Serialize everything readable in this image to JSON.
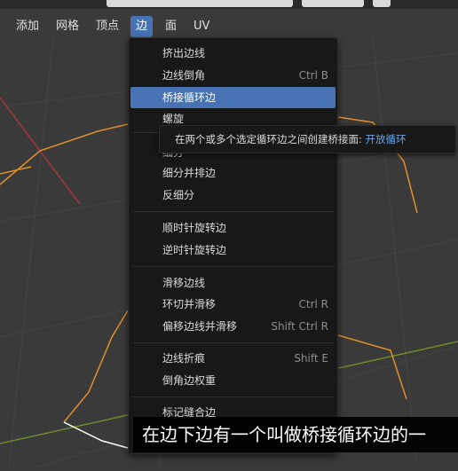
{
  "colors": {
    "viewport_bg": "#3a3a3a",
    "grid": "#444444",
    "x_axis": "#a1383f",
    "y_axis": "#6e8b2a",
    "mesh_edge": "#e0902a",
    "selected_edge": "#ffffff",
    "highlight": "#4772b3",
    "menu_bg": "#181818",
    "tooltip_accent": "#6ea6e6"
  },
  "menubar": {
    "items": [
      {
        "label": "添加",
        "active": false
      },
      {
        "label": "网格",
        "active": false
      },
      {
        "label": "顶点",
        "active": false
      },
      {
        "label": "边",
        "active": true
      },
      {
        "label": "面",
        "active": false
      },
      {
        "label": "UV",
        "active": false
      }
    ]
  },
  "dropdown": {
    "items": [
      {
        "label": "挤出边线",
        "shortcut": ""
      },
      {
        "label": "边线倒角",
        "shortcut": "Ctrl B"
      },
      {
        "label": "桥接循环边",
        "shortcut": "",
        "highlighted": true
      },
      {
        "label": "螺旋",
        "shortcut": ""
      },
      {
        "label": "细分",
        "shortcut": ""
      },
      {
        "label": "细分并排边",
        "shortcut": ""
      },
      {
        "label": "反细分",
        "shortcut": ""
      },
      {
        "label": "顺时针旋转边",
        "shortcut": ""
      },
      {
        "label": "逆时针旋转边",
        "shortcut": ""
      },
      {
        "label": "滑移边线",
        "shortcut": ""
      },
      {
        "label": "环切并滑移",
        "shortcut": "Ctrl R"
      },
      {
        "label": "偏移边线并滑移",
        "shortcut": "Shift Ctrl R"
      },
      {
        "label": "边线折痕",
        "shortcut": "Shift E"
      },
      {
        "label": "倒角边权重",
        "shortcut": ""
      },
      {
        "label": "标记缝合边",
        "shortcut": ""
      }
    ]
  },
  "tooltip": {
    "text": "在两个或多个选定循环边之间创建桥接面:",
    "accent": "开放循环"
  },
  "subtitle": {
    "text": "在边下边有一个叫做桥接循环边的一"
  }
}
